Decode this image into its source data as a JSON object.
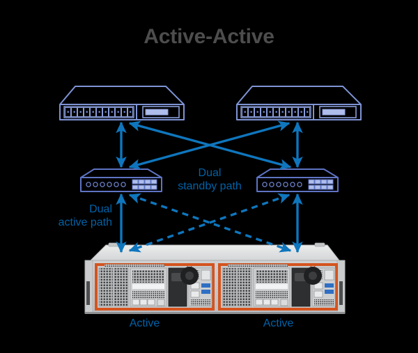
{
  "title": "Active-Active",
  "colors": {
    "background": "#000000",
    "title_gray": "#4d4d4d",
    "arrow_blue": "#0f76bd",
    "label_blue": "#0062a8",
    "device_outline": "#7f94d6",
    "device_fill_light": "#aebdea",
    "chassis_gray": "#d9dadc",
    "chassis_top": "#e2e3e5",
    "controller_orange": "#d4541e"
  },
  "labels": {
    "dual_standby_path": "Dual\nstandby path",
    "dual_active_path": "Dual\nactive path",
    "controller_a": "Active",
    "controller_b": "Active"
  },
  "topology": {
    "tier_top": {
      "name": "core-switches",
      "count": 2,
      "ports": 11,
      "devices": [
        {
          "id": "switch-top-left",
          "label": ""
        },
        {
          "id": "switch-top-right",
          "label": ""
        }
      ]
    },
    "tier_mid": {
      "name": "access-switches",
      "count": 2,
      "leds": 7,
      "port_grid": {
        "rows": 2,
        "cols": 5
      },
      "devices": [
        {
          "id": "switch-mid-left",
          "label": ""
        },
        {
          "id": "switch-mid-right",
          "label": ""
        }
      ]
    },
    "tier_bottom": {
      "name": "storage-array",
      "controllers": [
        {
          "id": "controller-a",
          "state": "Active"
        },
        {
          "id": "controller-b",
          "state": "Active"
        }
      ]
    },
    "links": [
      {
        "from": "switch-top-left",
        "to": "switch-mid-left",
        "style": "solid",
        "arrows": "both",
        "kind": "active"
      },
      {
        "from": "switch-top-right",
        "to": "switch-mid-right",
        "style": "solid",
        "arrows": "both",
        "kind": "active"
      },
      {
        "from": "switch-top-left",
        "to": "switch-mid-right",
        "style": "solid",
        "arrows": "both",
        "kind": "active"
      },
      {
        "from": "switch-top-right",
        "to": "switch-mid-left",
        "style": "solid",
        "arrows": "both",
        "kind": "active"
      },
      {
        "from": "switch-mid-left",
        "to": "controller-a",
        "style": "solid",
        "arrows": "both",
        "kind": "active"
      },
      {
        "from": "switch-mid-right",
        "to": "controller-b",
        "style": "solid",
        "arrows": "both",
        "kind": "active"
      },
      {
        "from": "switch-mid-left",
        "to": "controller-b",
        "style": "dashed",
        "arrows": "both",
        "kind": "standby"
      },
      {
        "from": "switch-mid-right",
        "to": "controller-a",
        "style": "dashed",
        "arrows": "both",
        "kind": "standby"
      }
    ]
  }
}
